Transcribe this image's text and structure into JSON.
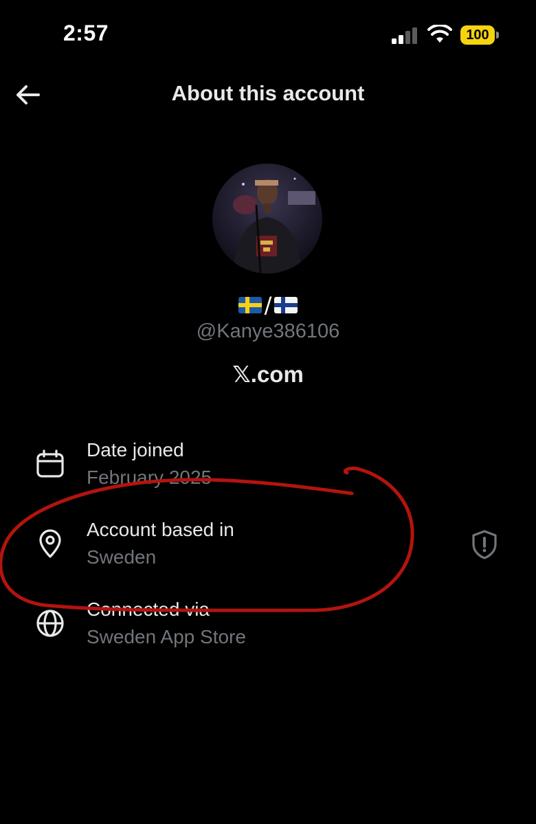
{
  "status_bar": {
    "time": "2:57",
    "battery": "100",
    "battery_color": "#f5d30f"
  },
  "header": {
    "title": "About this account",
    "back_icon": "arrow-left-icon"
  },
  "profile": {
    "display_name_separator": "/",
    "flags": [
      "sweden-flag",
      "finland-flag"
    ],
    "handle": "@Kanye386106",
    "site": "𝕏.com"
  },
  "details": [
    {
      "label": "Date joined",
      "value": "February 2025",
      "icon": "calendar-icon"
    },
    {
      "label": "Account based in",
      "value": "Sweden",
      "icon": "location-pin-icon"
    },
    {
      "label": "Connected via",
      "value": "Sweden App Store",
      "icon": "globe-icon"
    }
  ],
  "annotation": {
    "color": "#b3140f"
  },
  "colors": {
    "background": "#000000",
    "primary_text": "#e7e9ea",
    "secondary_text": "#71767b"
  }
}
